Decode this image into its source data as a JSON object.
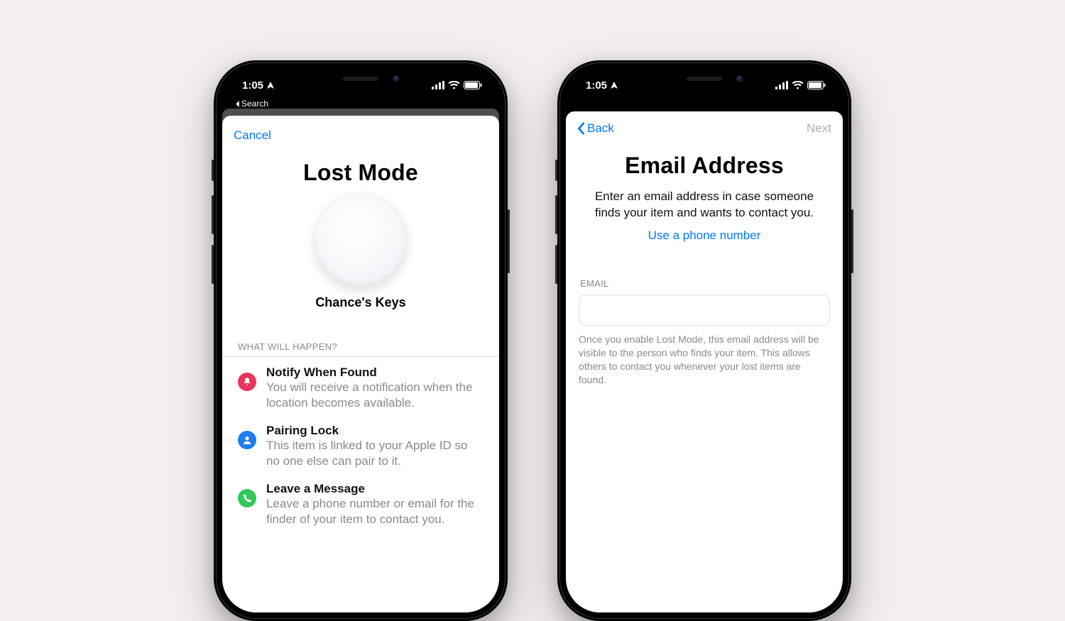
{
  "status": {
    "time_left": "1:05",
    "time_right": "1:05",
    "breadcrumb": "Search"
  },
  "screen1": {
    "nav": {
      "cancel": "Cancel"
    },
    "title": "Lost Mode",
    "item_name": "Chance's Keys",
    "section_header": "WHAT WILL HAPPEN?",
    "rows": [
      {
        "title": "Notify When Found",
        "desc": "You will receive a notification when the location becomes available."
      },
      {
        "title": "Pairing Lock",
        "desc": "This item is linked to your Apple ID so no one else can pair to it."
      },
      {
        "title": "Leave a Message",
        "desc": "Leave a phone number or email for the finder of your item to contact you."
      }
    ]
  },
  "screen2": {
    "nav": {
      "back": "Back",
      "next": "Next"
    },
    "title": "Email Address",
    "subtitle": "Enter an email address in case someone finds your item and wants to contact you.",
    "alt_link": "Use a phone number",
    "field": {
      "label": "EMAIL",
      "value": ""
    },
    "footnote": "Once you enable Lost Mode, this email address will be visible to the person who finds your item. This allows others to contact you whenever your lost items are found."
  }
}
